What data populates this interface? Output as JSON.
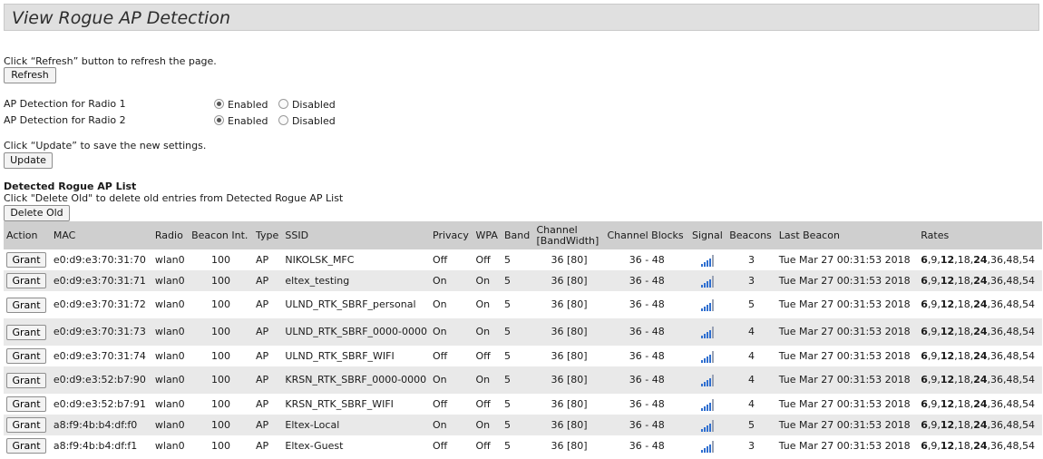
{
  "page": {
    "title": "View Rogue AP Detection",
    "refresh_hint": "Click “Refresh” button to refresh the page.",
    "refresh_label": "Refresh",
    "radio1_label": "AP Detection for Radio 1",
    "radio2_label": "AP Detection for Radio 2",
    "enabled_label": "Enabled",
    "disabled_label": "Disabled",
    "radio1_state": "Enabled",
    "radio2_state": "Enabled",
    "update_hint": "Click “Update” to save the new settings.",
    "update_label": "Update",
    "list_title": "Detected Rogue AP List",
    "delete_hint": "Click \"Delete Old\" to delete old entries from Detected Rogue AP List",
    "delete_label": "Delete Old"
  },
  "table": {
    "headers": [
      "Action",
      "MAC",
      "Radio",
      "Beacon Int.",
      "Type",
      "SSID",
      "Privacy",
      "WPA",
      "Band",
      "Channel [BandWidth]",
      "Channel Blocks",
      "Signal",
      "Beacons",
      "Last Beacon",
      "Rates"
    ],
    "grant_label": "Grant",
    "signal_icon": "signal-bars-icon",
    "signal_color": "#2f6fd0",
    "rates_bold": [
      "6",
      "12",
      "24"
    ],
    "rows": [
      {
        "mac": "e0:d9:e3:70:31:70",
        "radio": "wlan0",
        "beacon_int": "100",
        "type": "AP",
        "ssid": "NIKOLSK_MFC",
        "privacy": "Off",
        "wpa": "Off",
        "band": "5",
        "channel": "36 [80]",
        "blocks": "36 - 48",
        "signal": 4,
        "beacons": "3",
        "last_beacon": "Tue Mar 27 00:31:53 2018",
        "rates": "6,9,12,18,24,36,48,54"
      },
      {
        "mac": "e0:d9:e3:70:31:71",
        "radio": "wlan0",
        "beacon_int": "100",
        "type": "AP",
        "ssid": "eltex_testing",
        "privacy": "On",
        "wpa": "On",
        "band": "5",
        "channel": "36 [80]",
        "blocks": "36 - 48",
        "signal": 4,
        "beacons": "3",
        "last_beacon": "Tue Mar 27 00:31:53 2018",
        "rates": "6,9,12,18,24,36,48,54"
      },
      {
        "mac": "e0:d9:e3:70:31:72",
        "radio": "wlan0",
        "beacon_int": "100",
        "type": "AP",
        "ssid": "ULND_RTK_SBRF_personal",
        "privacy": "On",
        "wpa": "On",
        "band": "5",
        "channel": "36 [80]",
        "blocks": "36 - 48",
        "signal": 4,
        "beacons": "5",
        "last_beacon": "Tue Mar 27 00:31:53 2018",
        "rates": "6,9,12,18,24,36,48,54"
      },
      {
        "mac": "e0:d9:e3:70:31:73",
        "radio": "wlan0",
        "beacon_int": "100",
        "type": "AP",
        "ssid": "ULND_RTK_SBRF_0000-0000",
        "privacy": "On",
        "wpa": "On",
        "band": "5",
        "channel": "36 [80]",
        "blocks": "36 - 48",
        "signal": 4,
        "beacons": "4",
        "last_beacon": "Tue Mar 27 00:31:53 2018",
        "rates": "6,9,12,18,24,36,48,54"
      },
      {
        "mac": "e0:d9:e3:70:31:74",
        "radio": "wlan0",
        "beacon_int": "100",
        "type": "AP",
        "ssid": "ULND_RTK_SBRF_WIFI",
        "privacy": "Off",
        "wpa": "Off",
        "band": "5",
        "channel": "36 [80]",
        "blocks": "36 - 48",
        "signal": 4,
        "beacons": "4",
        "last_beacon": "Tue Mar 27 00:31:53 2018",
        "rates": "6,9,12,18,24,36,48,54"
      },
      {
        "mac": "e0:d9:e3:52:b7:90",
        "radio": "wlan0",
        "beacon_int": "100",
        "type": "AP",
        "ssid": "KRSN_RTK_SBRF_0000-0000",
        "privacy": "On",
        "wpa": "On",
        "band": "5",
        "channel": "36 [80]",
        "blocks": "36 - 48",
        "signal": 4,
        "beacons": "4",
        "last_beacon": "Tue Mar 27 00:31:53 2018",
        "rates": "6,9,12,18,24,36,48,54"
      },
      {
        "mac": "e0:d9:e3:52:b7:91",
        "radio": "wlan0",
        "beacon_int": "100",
        "type": "AP",
        "ssid": "KRSN_RTK_SBRF_WIFI",
        "privacy": "Off",
        "wpa": "Off",
        "band": "5",
        "channel": "36 [80]",
        "blocks": "36 - 48",
        "signal": 4,
        "beacons": "4",
        "last_beacon": "Tue Mar 27 00:31:53 2018",
        "rates": "6,9,12,18,24,36,48,54"
      },
      {
        "mac": "a8:f9:4b:b4:df:f0",
        "radio": "wlan0",
        "beacon_int": "100",
        "type": "AP",
        "ssid": "Eltex-Local",
        "privacy": "On",
        "wpa": "On",
        "band": "5",
        "channel": "36 [80]",
        "blocks": "36 - 48",
        "signal": 4,
        "beacons": "5",
        "last_beacon": "Tue Mar 27 00:31:53 2018",
        "rates": "6,9,12,18,24,36,48,54"
      },
      {
        "mac": "a8:f9:4b:b4:df:f1",
        "radio": "wlan0",
        "beacon_int": "100",
        "type": "AP",
        "ssid": "Eltex-Guest",
        "privacy": "Off",
        "wpa": "Off",
        "band": "5",
        "channel": "36 [80]",
        "blocks": "36 - 48",
        "signal": 4,
        "beacons": "3",
        "last_beacon": "Tue Mar 27 00:31:53 2018",
        "rates": "6,9,12,18,24,36,48,54"
      }
    ]
  }
}
